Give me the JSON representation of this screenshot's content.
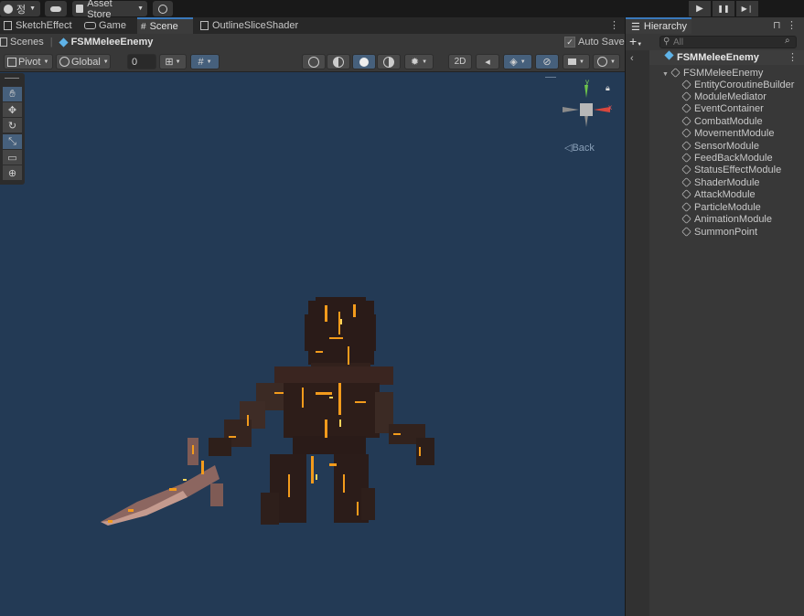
{
  "topbar": {
    "account_label": "정",
    "store_label": "Asset Store",
    "play_icons": [
      "▶",
      "❚❚",
      "▶❘"
    ]
  },
  "tabs": [
    {
      "label": "SketchEffect",
      "icon": "scene-icon"
    },
    {
      "label": "Game",
      "icon": "gamepad-icon"
    },
    {
      "label": "Scene",
      "icon": "grid-icon"
    },
    {
      "label": "OutlineSliceShader",
      "icon": "shader-icon"
    }
  ],
  "scene_header": {
    "scenes_label": "Scenes",
    "prefab_name": "FSMMeleeEnemy",
    "auto_save_label": "Auto Save",
    "auto_save_checked": true
  },
  "toolbar": {
    "pivot_label": "Pivot",
    "global_label": "Global",
    "snap_value": "0",
    "mode_2d_label": "2D"
  },
  "tool_palette": [
    "hand-tool",
    "move-tool",
    "rotate-tool",
    "scale-tool",
    "rect-tool",
    "transform-tool"
  ],
  "gizmo": {
    "back_label": "Back",
    "axes": {
      "y": "y",
      "x": "x"
    }
  },
  "hierarchy": {
    "tab_label": "Hierarchy",
    "search_placeholder": "All",
    "root": "FSMMeleeEnemy",
    "child": "FSMMeleeEnemy",
    "items": [
      "EntityCoroutineBuilder",
      "ModuleMediator",
      "EventContainer",
      "CombatModule",
      "MovementModule",
      "SensorModule",
      "FeedBackModule",
      "StatusEffectModule",
      "ShaderModule",
      "AttackModule",
      "ParticleModule",
      "AnimationModule",
      "SummonPoint"
    ]
  },
  "colors": {
    "scene_bg": "#233a55",
    "accent": "#3a79bb",
    "panel": "#383838",
    "ember": "#f39b1c"
  }
}
